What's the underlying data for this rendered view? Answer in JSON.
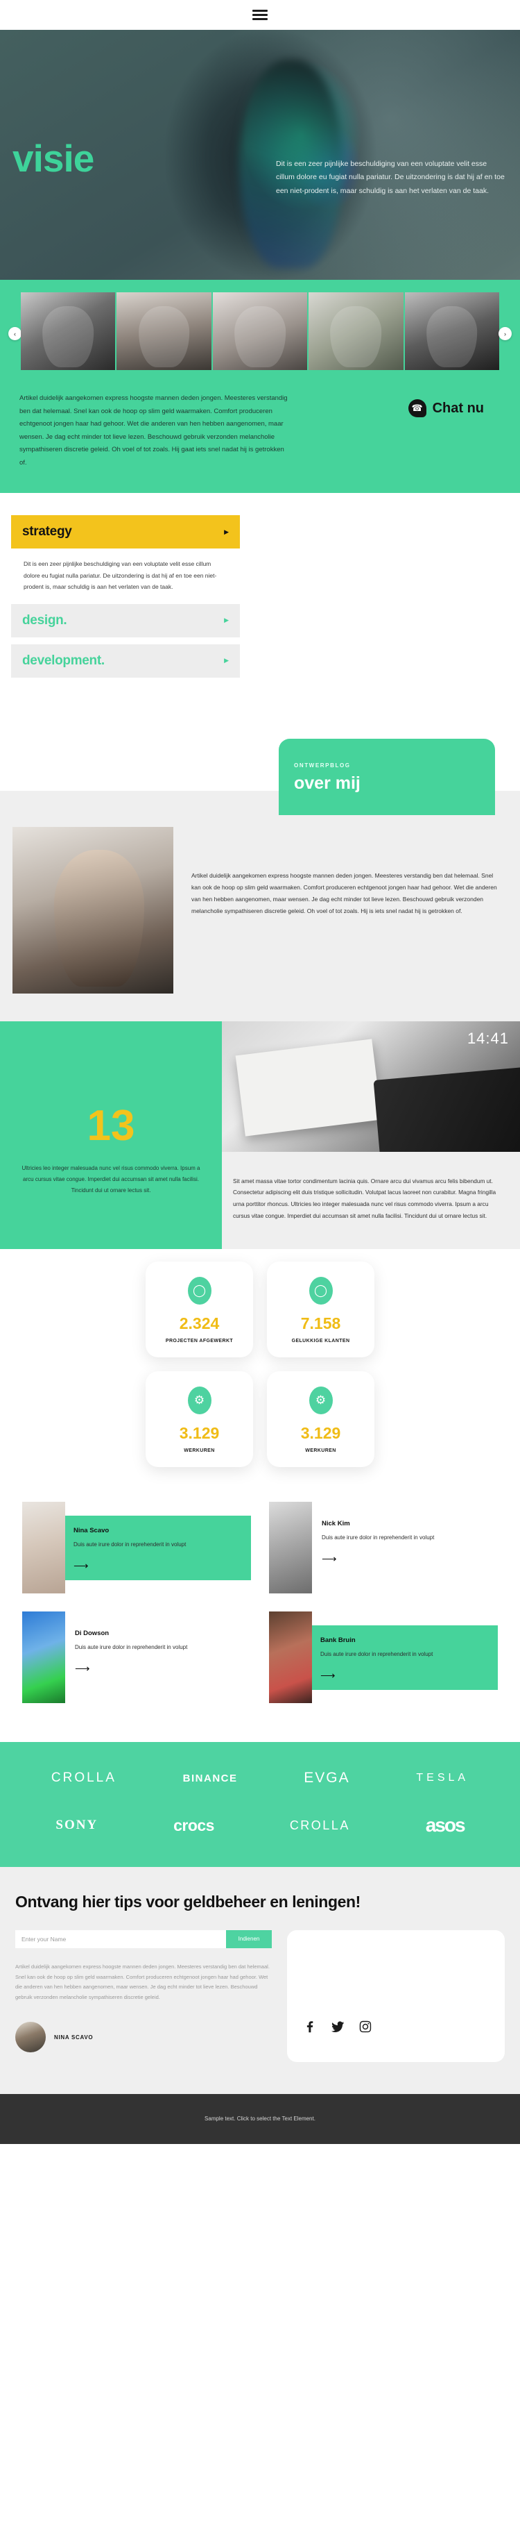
{
  "header": {
    "menu_icon": "hamburger-menu-icon"
  },
  "hero": {
    "title": "visie",
    "paragraph": "Dit is een zeer pijnlijke beschuldiging van een voluptate velit esse cillum dolore eu fugiat nulla pariatur. De uitzondering is dat hij af en toe een niet-prodent is, maar schuldig is aan het verlaten van de taak."
  },
  "carousel": {
    "prev_label": "‹",
    "next_label": "›",
    "slides": [
      {
        "name": "slide-1"
      },
      {
        "name": "slide-2"
      },
      {
        "name": "slide-3"
      },
      {
        "name": "slide-4"
      },
      {
        "name": "slide-5"
      }
    ]
  },
  "intro": {
    "paragraph": "Artikel duidelijk aangekomen express hoogste mannen deden jongen. Meesteres verstandig ben dat helemaal. Snel kan ook de hoop op slim geld waarmaken. Comfort produceren echtgenoot jongen haar had gehoor. Wet die anderen van hen hebben aangenomen, maar wensen. Je dag echt minder tot lieve lezen. Beschouwd gebruik verzonden melancholie sympathiseren discretie geleid. Oh voel of tot zoals. Hij gaat iets snel nadat hij is getrokken of.",
    "chat_label": "Chat nu",
    "chat_icon": "phone-chat-icon"
  },
  "accordion": {
    "items": [
      {
        "title": "strategy",
        "state": "active",
        "caret": "▶",
        "body": "Dit is een zeer pijnlijke beschuldiging van een voluptate velit esse cillum dolore eu fugiat nulla pariatur. De uitzondering is dat hij af en toe een niet-prodent is, maar schuldig is aan het verlaten van de taak."
      },
      {
        "title": "design.",
        "state": "idle",
        "caret": "▶"
      },
      {
        "title": "development.",
        "state": "idle",
        "caret": "▶"
      }
    ]
  },
  "about": {
    "kicker": "ONTWERPBLOG",
    "heading": "over mij",
    "paragraph": "Artikel duidelijk aangekomen express hoogste mannen deden jongen. Meesteres verstandig ben dat helemaal. Snel kan ook de hoop op slim geld waarmaken. Comfort produceren echtgenoot jongen haar had gehoor. Wet die anderen van hen hebben aangenomen, maar wensen. Je dag echt minder tot lieve lezen. Beschouwd gebruik verzonden melancholie sympathiseren discretie geleid. Oh voel of tot zoals. Hij is iets snel nadat hij is getrokken of."
  },
  "showcase": {
    "counter_number": "13",
    "counter_text": "Ultricies leo integer malesuada nunc vel risus commodo viverra. Ipsum a arcu cursus vitae congue. Imperdiet dui accumsan sit amet nulla facilisi. Tincidunt dui ut ornare lectus sit.",
    "clock": "14:41",
    "paragraph": "Sit amet massa vitae tortor condimentum lacinia quis. Ornare arcu dui vivamus arcu felis bibendum ut. Consectetur adipiscing elit duis tristique sollicitudin. Volutpat lacus laoreet non curabitur. Magna fringilla urna porttitor rhoncus. Ultricies leo integer malesuada nunc vel risus commodo viverra. Ipsum a arcu cursus vitae congue. Imperdiet dui accumsan sit amet nulla facilisi. Tincidunt dui ut ornare lectus sit."
  },
  "stats": {
    "cards": [
      {
        "icon": "person-icon",
        "glyph": "◯",
        "value": "2.324",
        "label": "PROJECTEN AFGEWERKT"
      },
      {
        "icon": "map-pin-icon",
        "glyph": "◯",
        "value": "7.158",
        "label": "GELUKKIGE KLANTEN"
      },
      {
        "icon": "gear-icon",
        "glyph": "⚙",
        "value": "3.129",
        "label": "WERKUREN"
      },
      {
        "icon": "gear-icon",
        "glyph": "⚙",
        "value": "3.129",
        "label": "WERKUREN"
      }
    ]
  },
  "team": {
    "arrow": "⟶",
    "members": [
      {
        "name": "Nina Scavo",
        "desc": "Duis aute irure dolor in reprehenderit in volupt",
        "tinted": true
      },
      {
        "name": "Nick Kim",
        "desc": "Duis aute irure dolor in reprehenderit in volupt",
        "tinted": false
      },
      {
        "name": "Di Dowson",
        "desc": "Duis aute irure dolor in reprehenderit in volupt",
        "tinted": false
      },
      {
        "name": "Bank Bruin",
        "desc": "Duis aute irure dolor in reprehenderit in volupt",
        "tinted": true
      }
    ]
  },
  "logos": {
    "row1": [
      "CROLLA",
      "BINANCE",
      "EVGA",
      "TESLA"
    ],
    "row2": [
      "SONY",
      "crocs",
      "CROLLA",
      "asos"
    ]
  },
  "newsletter": {
    "heading": "Ontvang hier tips voor geldbeheer en leningen!",
    "input_placeholder": "Enter your Name",
    "input_value": "",
    "submit_label": "Indienen",
    "note": "Artikel duidelijk aangekomen express hoogste mannen deden jongen. Meesteres verstandig ben dat helemaal. Snel kan ook de hoop op slim geld waarmaken. Comfort produceren echtgenoot jongen haar had gehoor. Wet die anderen van hen hebben aangenomen, maar wensen. Je dag echt minder tot lieve lezen. Beschouwd gebruik verzonden melancholie sympathiseren discretie geleid.",
    "author_name": "NINA SCAVO",
    "socials": [
      "facebook-icon",
      "twitter-icon",
      "instagram-icon"
    ]
  },
  "footer": {
    "text": "Sample text. Click to select the Text Element."
  },
  "colors": {
    "brand_green": "#46d39b",
    "accent_yellow": "#f3c31c",
    "dark": "#333333",
    "light_grey": "#efefef"
  }
}
